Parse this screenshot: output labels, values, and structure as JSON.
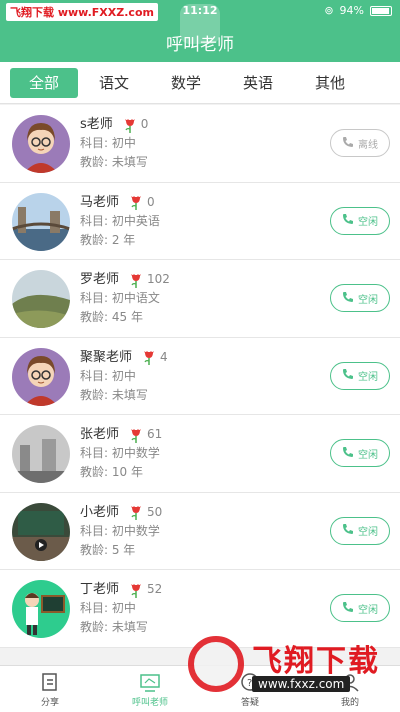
{
  "status": {
    "watermark_text": "飞翔下载 www.FXXZ.com",
    "time": "11:12",
    "battery": "94%",
    "battery_level": 0.94
  },
  "header": {
    "title": "呼叫老师"
  },
  "tabs": [
    {
      "label": "全部",
      "active": true
    },
    {
      "label": "语文"
    },
    {
      "label": "数学"
    },
    {
      "label": "英语"
    },
    {
      "label": "其他"
    }
  ],
  "teachers": [
    {
      "name": "s老师",
      "likes": "0",
      "subject": "科目: 初中",
      "years": "教龄: 未填写",
      "status": "离线",
      "online": false,
      "avatar": "cartoon-girl"
    },
    {
      "name": "马老师",
      "likes": "0",
      "subject": "科目: 初中英语",
      "years": "教龄: 2 年",
      "status": "空闲",
      "online": true,
      "avatar": "bridge-photo"
    },
    {
      "name": "罗老师",
      "likes": "102",
      "subject": "科目: 初中语文",
      "years": "教龄: 45 年",
      "status": "空闲",
      "online": true,
      "avatar": "landscape-photo"
    },
    {
      "name": "聚聚老师",
      "likes": "4",
      "subject": "科目: 初中",
      "years": "教龄: 未填写",
      "status": "空闲",
      "online": true,
      "avatar": "cartoon-girl"
    },
    {
      "name": "张老师",
      "likes": "61",
      "subject": "科目: 初中数学",
      "years": "教龄: 10 年",
      "status": "空闲",
      "online": true,
      "avatar": "foggy-photo"
    },
    {
      "name": "小老师",
      "likes": "50",
      "subject": "科目: 初中数学",
      "years": "教龄: 5 年",
      "status": "空闲",
      "online": true,
      "avatar": "classroom-photo"
    },
    {
      "name": "丁老师",
      "likes": "52",
      "subject": "科目: 初中",
      "years": "教龄: 未填写",
      "status": "空闲",
      "online": true,
      "avatar": "teacher-cartoon"
    }
  ],
  "tabbar": [
    {
      "label": "分享",
      "icon": "share-icon"
    },
    {
      "label": "呼叫老师",
      "icon": "call-teacher-icon",
      "active": true
    },
    {
      "label": "答疑",
      "icon": "qa-icon"
    },
    {
      "label": "我的",
      "icon": "profile-icon"
    }
  ],
  "watermark": {
    "title": "飞翔下载",
    "url": "www.fxxz.com"
  },
  "colors": {
    "accent": "#4cc18a",
    "flower": "#e53935",
    "watermark": "#e01b22"
  }
}
